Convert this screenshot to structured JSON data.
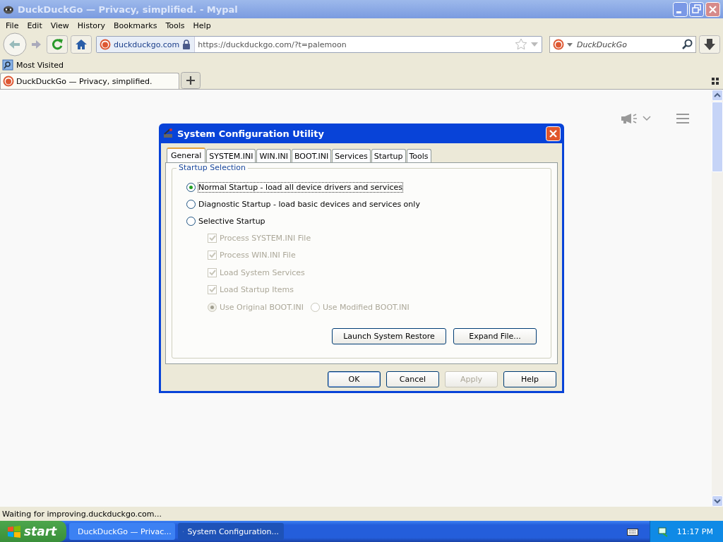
{
  "window": {
    "title": "DuckDuckGo — Privacy, simplified. - Mypal",
    "active": false
  },
  "menu": [
    "File",
    "Edit",
    "View",
    "History",
    "Bookmarks",
    "Tools",
    "Help"
  ],
  "navbar": {
    "identity": "duckduckgo.com",
    "url": "https://duckduckgo.com/?t=palemoon",
    "search": {
      "placeholder": "DuckDuckGo"
    }
  },
  "bookmarks": [
    "Most Visited"
  ],
  "tabs": [
    {
      "label": "DuckDuckGo — Privacy, simplified.",
      "selected": true
    }
  ],
  "dialog": {
    "title": "System Configuration Utility",
    "tabs": [
      {
        "label": "General",
        "selected": true
      },
      {
        "label": "SYSTEM.INI",
        "selected": false
      },
      {
        "label": "WIN.INI",
        "selected": false
      },
      {
        "label": "BOOT.INI",
        "selected": false
      },
      {
        "label": "Services",
        "selected": false
      },
      {
        "label": "Startup",
        "selected": false
      },
      {
        "label": "Tools",
        "selected": false
      }
    ],
    "group_title": "Startup Selection",
    "startup_options": [
      {
        "label": "Normal Startup - load all device drivers and services",
        "selected": true
      },
      {
        "label": "Diagnostic Startup - load basic devices and services only",
        "selected": false
      },
      {
        "label": "Selective Startup",
        "selected": false
      }
    ],
    "selective_items": [
      {
        "label": "Process SYSTEM.INI File",
        "checked": true,
        "disabled": true
      },
      {
        "label": "Process WIN.INI File",
        "checked": true,
        "disabled": true
      },
      {
        "label": "Load System Services",
        "checked": true,
        "disabled": true
      },
      {
        "label": "Load Startup Items",
        "checked": true,
        "disabled": true
      }
    ],
    "boot_ini_options": [
      {
        "label": "Use Original BOOT.INI",
        "selected": true,
        "disabled": true
      },
      {
        "label": "Use Modified BOOT.INI",
        "selected": false,
        "disabled": true
      }
    ],
    "actions": [
      "Launch System Restore",
      "Expand File..."
    ],
    "buttons": [
      {
        "label": "OK",
        "disabled": false
      },
      {
        "label": "Cancel",
        "disabled": false
      },
      {
        "label": "Apply",
        "disabled": true
      },
      {
        "label": "Help",
        "disabled": false
      }
    ]
  },
  "status_bar": "Waiting for improving.duckduckgo.com...",
  "taskbar": {
    "start": "start",
    "tasks": [
      {
        "label": "DuckDuckGo — Privac...",
        "selected": false
      },
      {
        "label": "System Configuration...",
        "selected": true
      }
    ],
    "clock": "11:17 PM"
  }
}
